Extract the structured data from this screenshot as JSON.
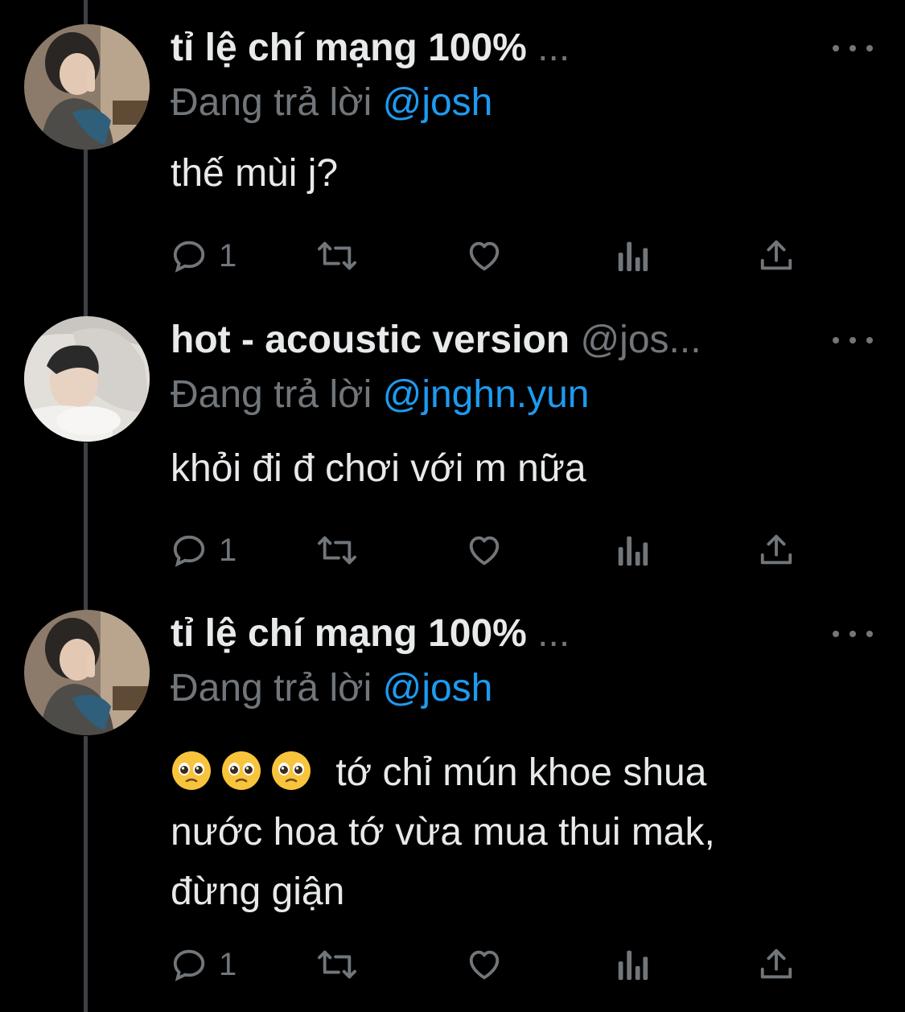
{
  "tweets": [
    {
      "name": "tỉ lệ chí mạng 100%",
      "handle": "...",
      "reply_label": "Đang trả lời",
      "reply_mention": "@josh",
      "text": "thế mùi j?",
      "reply_count": "1",
      "avatar": "avatar-photo-person-peace-sign"
    },
    {
      "name": "hot - acoustic version",
      "handle": "@jos...",
      "reply_label": "Đang trả lời",
      "reply_mention": "@jnghn.yun",
      "text": "khỏi đi đ chơi với m nữa",
      "reply_count": "1",
      "avatar": "avatar-photo-person-lying-on-pillow"
    },
    {
      "name": "tỉ lệ chí mạng 100%",
      "handle": "...",
      "reply_label": "Đang trả lời",
      "reply_mention": "@josh",
      "emoji": [
        "pleading-face",
        "pleading-face",
        "pleading-face"
      ],
      "text_line1": "tớ chỉ mún khoe shua",
      "text_line2": "nước hoa tớ vừa mua thui mak,",
      "text_line3": "đừng giận",
      "reply_count": "1",
      "avatar": "avatar-photo-person-peace-sign"
    }
  ],
  "icons": [
    "reply-icon",
    "retweet-icon",
    "like-icon",
    "views-icon",
    "share-icon",
    "more-icon"
  ],
  "colors": {
    "background": "#000000",
    "text": "#e7e9ea",
    "secondary": "#71767b",
    "mention": "#1d9bf0",
    "thread_line": "#3e4144"
  }
}
